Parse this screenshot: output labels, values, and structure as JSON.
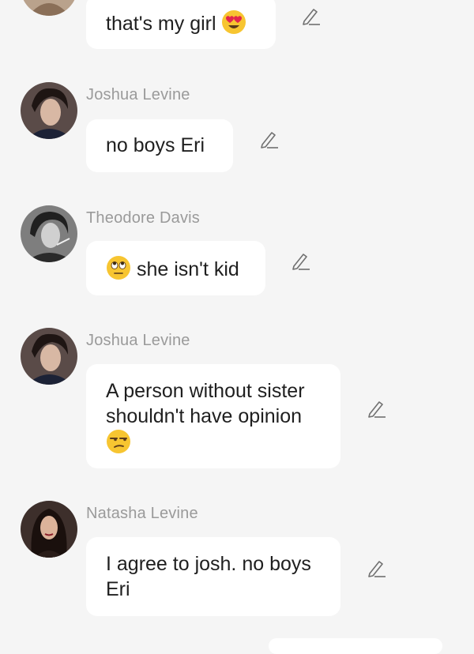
{
  "messages": [
    {
      "sender": "",
      "lines": [
        "that's my girl"
      ],
      "emoji": "heart-eyes-emoji"
    },
    {
      "sender": "Joshua Levine",
      "lines": [
        "no boys Eri"
      ],
      "avatar": "avatar-joshua-levine"
    },
    {
      "sender": "Theodore Davis",
      "lines": [
        "she isn't kid"
      ],
      "emoji": "eye-roll-emoji",
      "avatar": "avatar-theodore-davis"
    },
    {
      "sender": "Joshua Levine",
      "lines": [
        "A person without sister",
        "shouldn't have opinion"
      ],
      "emoji": "unamused-emoji",
      "avatar": "avatar-joshua-levine"
    },
    {
      "sender": "Natasha Levine",
      "lines": [
        "I agree to josh. no boys",
        "Eri"
      ],
      "avatar": "avatar-natasha-levine"
    }
  ],
  "icons": {
    "edit": "pencil-edit-icon"
  },
  "colors": {
    "background": "#f5f5f5",
    "bubble": "#ffffff",
    "sender_name": "#9a9a9a",
    "message_text": "#1f1f1f",
    "edit_icon": "#707070"
  }
}
